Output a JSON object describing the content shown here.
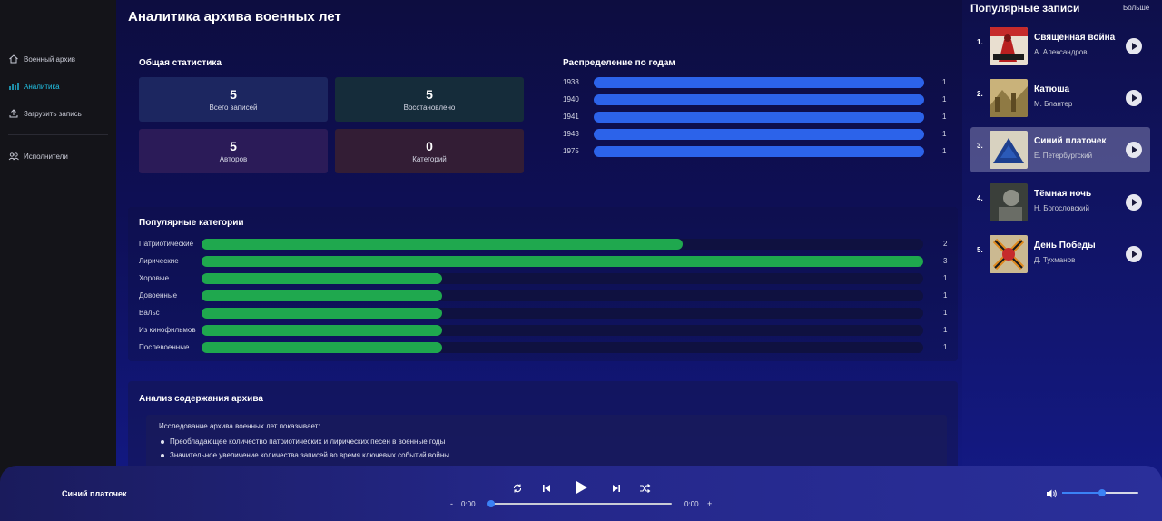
{
  "sidebar": {
    "items": [
      {
        "label": "Военный архив",
        "icon": "home-icon"
      },
      {
        "label": "Аналитика",
        "icon": "chart-icon"
      },
      {
        "label": "Загрузить запись",
        "icon": "upload-icon"
      },
      {
        "label": "Исполнители",
        "icon": "users-icon"
      }
    ],
    "active_color": "#22c3e6"
  },
  "main": {
    "title": "Аналитика архива военных лет",
    "stats_title": "Общая статистика",
    "stats": [
      {
        "value": "5",
        "label": "Всего записей",
        "color": "#1c2660"
      },
      {
        "value": "5",
        "label": "Восстановлено",
        "color": "#152c3a"
      },
      {
        "value": "5",
        "label": "Авторов",
        "color": "#2b1b58"
      },
      {
        "value": "0",
        "label": "Категорий",
        "color": "#331d35"
      }
    ],
    "years_title": "Распределение по годам",
    "years": [
      {
        "year": "1938",
        "count": "1",
        "fraction": 1.0
      },
      {
        "year": "1940",
        "count": "1",
        "fraction": 1.0
      },
      {
        "year": "1941",
        "count": "1",
        "fraction": 1.0
      },
      {
        "year": "1943",
        "count": "1",
        "fraction": 1.0
      },
      {
        "year": "1975",
        "count": "1",
        "fraction": 1.0
      }
    ],
    "categories_title": "Популярные категории",
    "categories": [
      {
        "label": "Патриотические",
        "count": "2",
        "fraction": 0.667
      },
      {
        "label": "Лирические",
        "count": "3",
        "fraction": 1.0
      },
      {
        "label": "Хоровые",
        "count": "1",
        "fraction": 0.333
      },
      {
        "label": "Довоенные",
        "count": "1",
        "fraction": 0.333
      },
      {
        "label": "Вальс",
        "count": "1",
        "fraction": 0.333
      },
      {
        "label": "Из кинофильмов",
        "count": "1",
        "fraction": 0.333
      },
      {
        "label": "Послевоенные",
        "count": "1",
        "fraction": 0.333
      }
    ],
    "analysis_title": "Анализ содержания архива",
    "analysis_intro": "Исследование архива военных лет показывает:",
    "analysis_points": [
      "Преобладающее количество патриотических и лирических песен в военные годы",
      "Значительное увеличение количества записей во время ключевых событий войны"
    ]
  },
  "popular": {
    "title": "Популярные записи",
    "more_label": "Больше",
    "tracks": [
      {
        "num": "1.",
        "title": "Священная война",
        "artist": "А. Александров"
      },
      {
        "num": "2.",
        "title": "Катюша",
        "artist": "М. Блантер"
      },
      {
        "num": "3.",
        "title": "Синий платочек",
        "artist": "Е. Петербургский"
      },
      {
        "num": "4.",
        "title": "Тёмная ночь",
        "artist": "Н. Богословский"
      },
      {
        "num": "5.",
        "title": "День Победы",
        "artist": "Д. Тухманов"
      }
    ]
  },
  "player": {
    "track_title": "Синий платочек",
    "seek_back": "-",
    "seek_forward": "+",
    "current_time": "0:00",
    "duration": "0:00",
    "progress": 0.0,
    "volume": 0.52
  }
}
